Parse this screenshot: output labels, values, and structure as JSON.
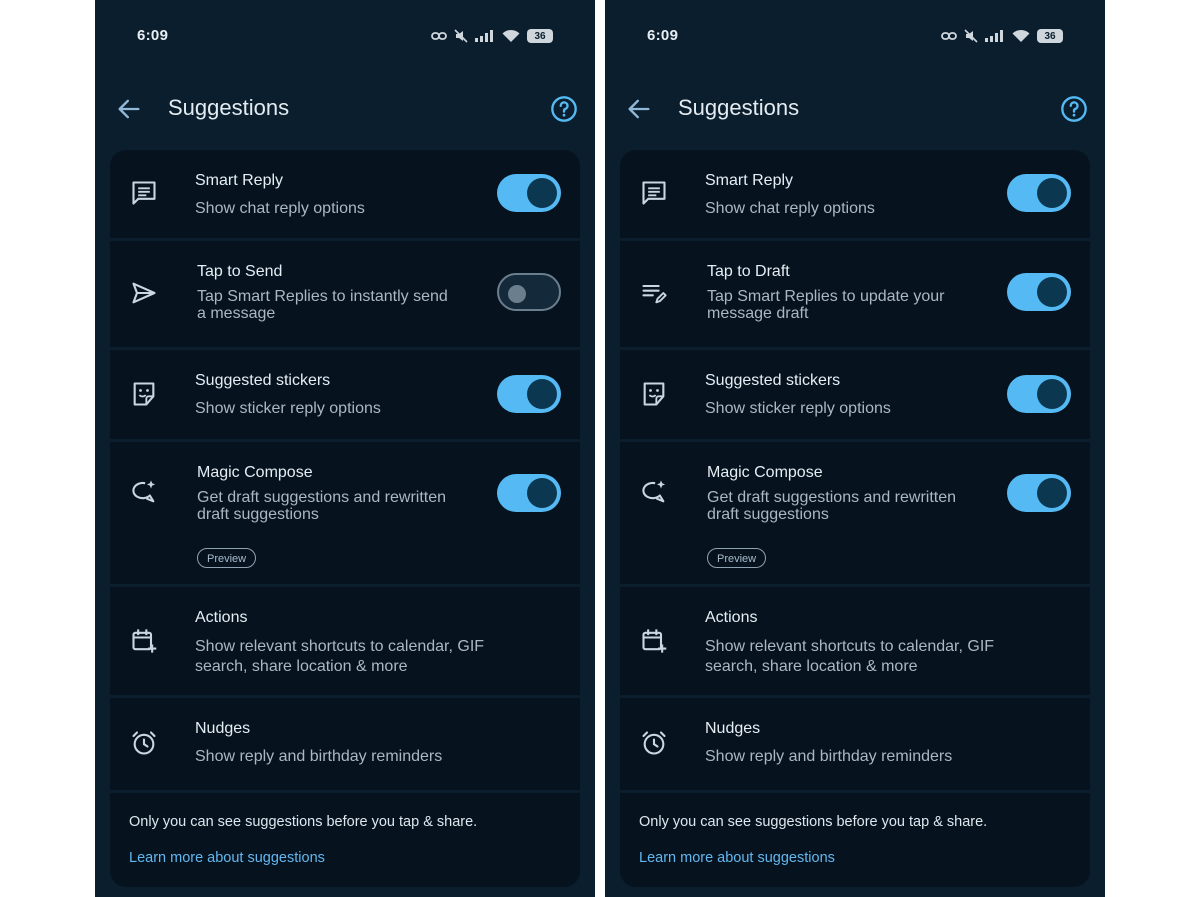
{
  "status_bar": {
    "time": "6:09",
    "battery": "36"
  },
  "header": {
    "title": "Suggestions"
  },
  "left": {
    "smart_reply": {
      "title": "Smart Reply",
      "subtitle": "Show chat reply options",
      "enabled": true
    },
    "tap_to_send": {
      "title": "Tap to Send",
      "subtitle_line1": "Tap Smart Replies to instantly send",
      "subtitle_line2": "a message",
      "enabled": false
    },
    "stickers": {
      "title": "Suggested stickers",
      "subtitle": "Show sticker reply options",
      "enabled": true
    },
    "magic_compose": {
      "title": "Magic Compose",
      "subtitle_line1": "Get draft suggestions and rewritten",
      "subtitle_line2": "draft suggestions",
      "badge": "Preview",
      "enabled": true
    },
    "actions": {
      "title": "Actions",
      "subtitle_line1": "Show relevant shortcuts to calendar, GIF",
      "subtitle_line2": "search, share location & more"
    },
    "nudges": {
      "title": "Nudges",
      "subtitle": "Show reply and birthday reminders"
    },
    "footer": {
      "note": "Only you can see suggestions before you tap & share.",
      "link": "Learn more about suggestions"
    }
  },
  "right": {
    "smart_reply": {
      "title": "Smart Reply",
      "subtitle": "Show chat reply options",
      "enabled": true
    },
    "tap_to_draft": {
      "title": "Tap to Draft",
      "subtitle_line1": "Tap Smart Replies to update your",
      "subtitle_line2": "message draft",
      "enabled": true
    },
    "stickers": {
      "title": "Suggested stickers",
      "subtitle": "Show sticker reply options",
      "enabled": true
    },
    "magic_compose": {
      "title": "Magic Compose",
      "subtitle_line1": "Get draft suggestions and rewritten",
      "subtitle_line2": "draft suggestions",
      "badge": "Preview",
      "enabled": true
    },
    "actions": {
      "title": "Actions",
      "subtitle_line1": "Show relevant shortcuts to calendar, GIF",
      "subtitle_line2": "search, share location & more"
    },
    "nudges": {
      "title": "Nudges",
      "subtitle": "Show reply and birthday reminders"
    },
    "footer": {
      "note": "Only you can see suggestions before you tap & share.",
      "link": "Learn more about suggestions"
    }
  },
  "icons": {
    "back": "arrow-back-icon",
    "help": "help-circle-icon",
    "smart_reply": "chat-message-icon",
    "tap_to_send": "send-icon",
    "tap_to_draft": "edit-note-icon",
    "stickers": "sticker-icon",
    "magic_compose": "magic-compose-icon",
    "actions": "calendar-add-icon",
    "nudges": "alarm-clock-icon"
  },
  "colors": {
    "background": "#0b1e2d",
    "card": "#06131f",
    "accent": "#55b9f3",
    "link": "#62b7f0"
  }
}
